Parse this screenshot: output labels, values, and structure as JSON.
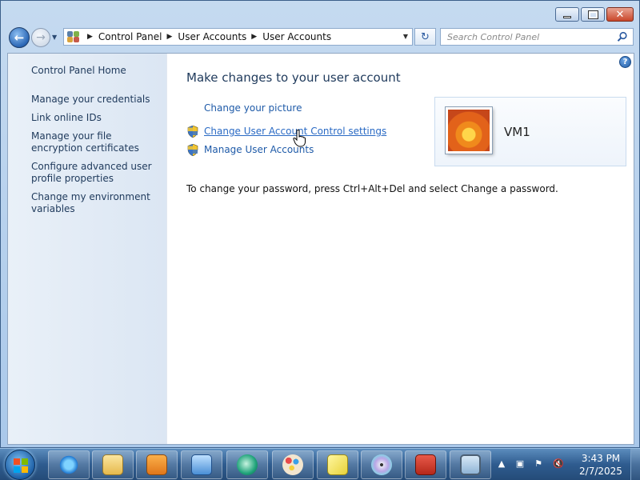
{
  "window": {
    "controls": {
      "minimize": "",
      "maximize": "",
      "close": "✕"
    }
  },
  "navigation": {
    "breadcrumbs": [
      "Control Panel",
      "User Accounts",
      "User Accounts"
    ],
    "search_placeholder": "Search Control Panel"
  },
  "sidebar": {
    "items": [
      {
        "label": "Control Panel Home"
      },
      {
        "label": "Manage your credentials"
      },
      {
        "label": "Link online IDs"
      },
      {
        "label": "Manage your file encryption certificates"
      },
      {
        "label": "Configure advanced user profile properties"
      },
      {
        "label": "Change my environment variables"
      }
    ]
  },
  "main": {
    "title": "Make changes to your user account",
    "tasks": [
      {
        "label": "Change your picture",
        "shield": false
      },
      {
        "label": "Change User Account Control settings",
        "shield": true
      },
      {
        "label": "Manage User Accounts",
        "shield": true
      }
    ],
    "password_note": "To change your password, press Ctrl+Alt+Del and select Change a password.",
    "user": {
      "name": "VM1"
    }
  },
  "taskbar": {
    "apps": [
      "internet-explorer-icon",
      "windows-explorer-icon",
      "media-player-icon",
      "remote-desktop-icon",
      "media-center-icon",
      "paint-icon",
      "sticky-notes-icon",
      "dvd-maker-icon",
      "toolbox-icon",
      "screen-icon"
    ],
    "clock": {
      "time": "3:43 PM",
      "date": "2/7/2025"
    }
  },
  "colors": {
    "link": "#1e5aa8",
    "heading": "#1e395b",
    "taskbar": "#2f5c8f"
  }
}
